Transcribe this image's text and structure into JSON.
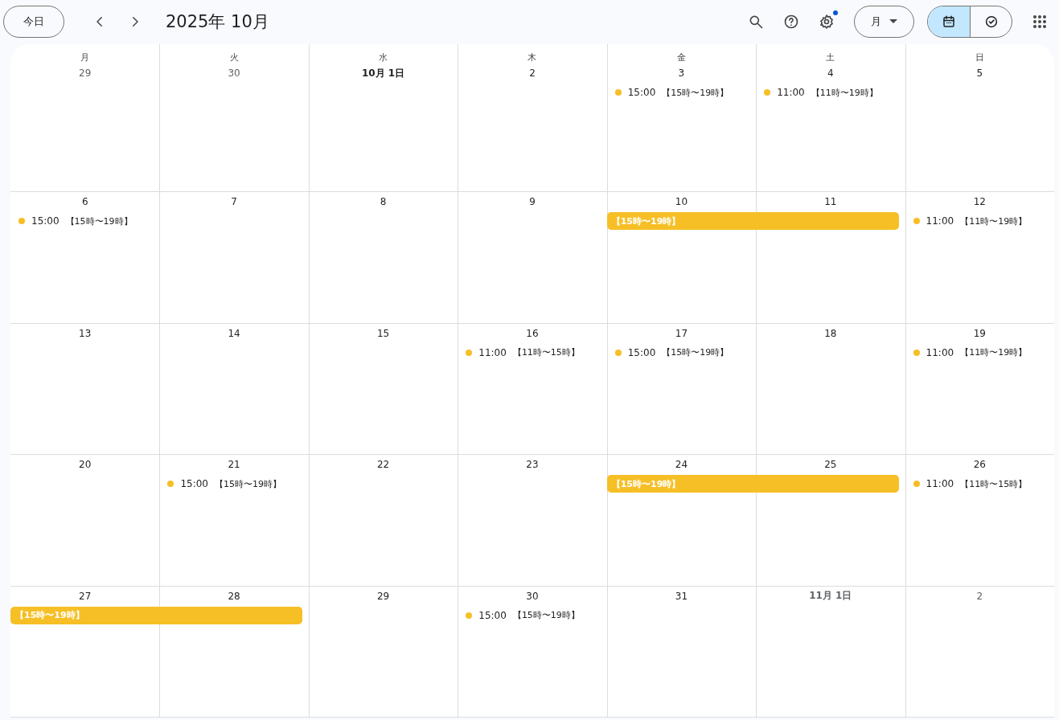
{
  "toolbar": {
    "today_button": "今日",
    "title": "2025年 10月",
    "settings_badge": true,
    "view_select": "月",
    "view_toggle": [
      {
        "kind": "calendar",
        "selected": true
      },
      {
        "kind": "tasks",
        "selected": false
      }
    ]
  },
  "weekdays": [
    "月",
    "火",
    "水",
    "木",
    "金",
    "土",
    "日"
  ],
  "weeks": [
    {
      "days": [
        {
          "date": "29",
          "current_month": false
        },
        {
          "date": "30",
          "current_month": false
        },
        {
          "date": "10月 1日",
          "current_month": true
        },
        {
          "date": "2",
          "current_month": true
        },
        {
          "date": "3",
          "current_month": true,
          "events": [
            {
              "time": "15:00",
              "title": "【15時〜19時】"
            }
          ]
        },
        {
          "date": "4",
          "current_month": true,
          "events": [
            {
              "time": "11:00",
              "title": "【11時〜19時】"
            }
          ]
        },
        {
          "date": "5",
          "current_month": true
        }
      ]
    },
    {
      "days": [
        {
          "date": "6",
          "current_month": true,
          "events": [
            {
              "time": "15:00",
              "title": "【15時〜19時】"
            }
          ]
        },
        {
          "date": "7",
          "current_month": true
        },
        {
          "date": "8",
          "current_month": true
        },
        {
          "date": "9",
          "current_month": true
        },
        {
          "date": "10",
          "current_month": true,
          "bar": {
            "title": "【15時〜19時】"
          }
        },
        {
          "date": "11",
          "current_month": true,
          "bar_continues": true
        },
        {
          "date": "12",
          "current_month": true,
          "events": [
            {
              "time": "11:00",
              "title": "【11時〜19時】"
            }
          ]
        }
      ]
    },
    {
      "days": [
        {
          "date": "13",
          "current_month": true
        },
        {
          "date": "14",
          "current_month": true
        },
        {
          "date": "15",
          "current_month": true
        },
        {
          "date": "16",
          "current_month": true,
          "events": [
            {
              "time": "11:00",
              "title": "【11時〜15時】"
            }
          ]
        },
        {
          "date": "17",
          "current_month": true,
          "events": [
            {
              "time": "15:00",
              "title": "【15時〜19時】"
            }
          ]
        },
        {
          "date": "18",
          "current_month": true
        },
        {
          "date": "19",
          "current_month": true,
          "events": [
            {
              "time": "11:00",
              "title": "【11時〜19時】"
            }
          ]
        }
      ]
    },
    {
      "days": [
        {
          "date": "20",
          "current_month": true
        },
        {
          "date": "21",
          "current_month": true,
          "events": [
            {
              "time": "15:00",
              "title": "【15時〜19時】"
            }
          ]
        },
        {
          "date": "22",
          "current_month": true
        },
        {
          "date": "23",
          "current_month": true
        },
        {
          "date": "24",
          "current_month": true,
          "bar": {
            "title": "【15時〜19時】"
          }
        },
        {
          "date": "25",
          "current_month": true,
          "bar_continues": true
        },
        {
          "date": "26",
          "current_month": true,
          "events": [
            {
              "time": "11:00",
              "title": "【11時〜15時】"
            }
          ]
        }
      ]
    },
    {
      "days": [
        {
          "date": "27",
          "current_month": true,
          "bar": {
            "title": "【15時〜19時】"
          }
        },
        {
          "date": "28",
          "current_month": true,
          "bar_continues": true
        },
        {
          "date": "29",
          "current_month": true
        },
        {
          "date": "30",
          "current_month": true,
          "events": [
            {
              "time": "15:00",
              "title": "【15時〜19時】"
            }
          ]
        },
        {
          "date": "31",
          "current_month": true
        },
        {
          "date": "11月 1日",
          "current_month": false
        },
        {
          "date": "2",
          "current_month": false
        }
      ]
    }
  ]
}
